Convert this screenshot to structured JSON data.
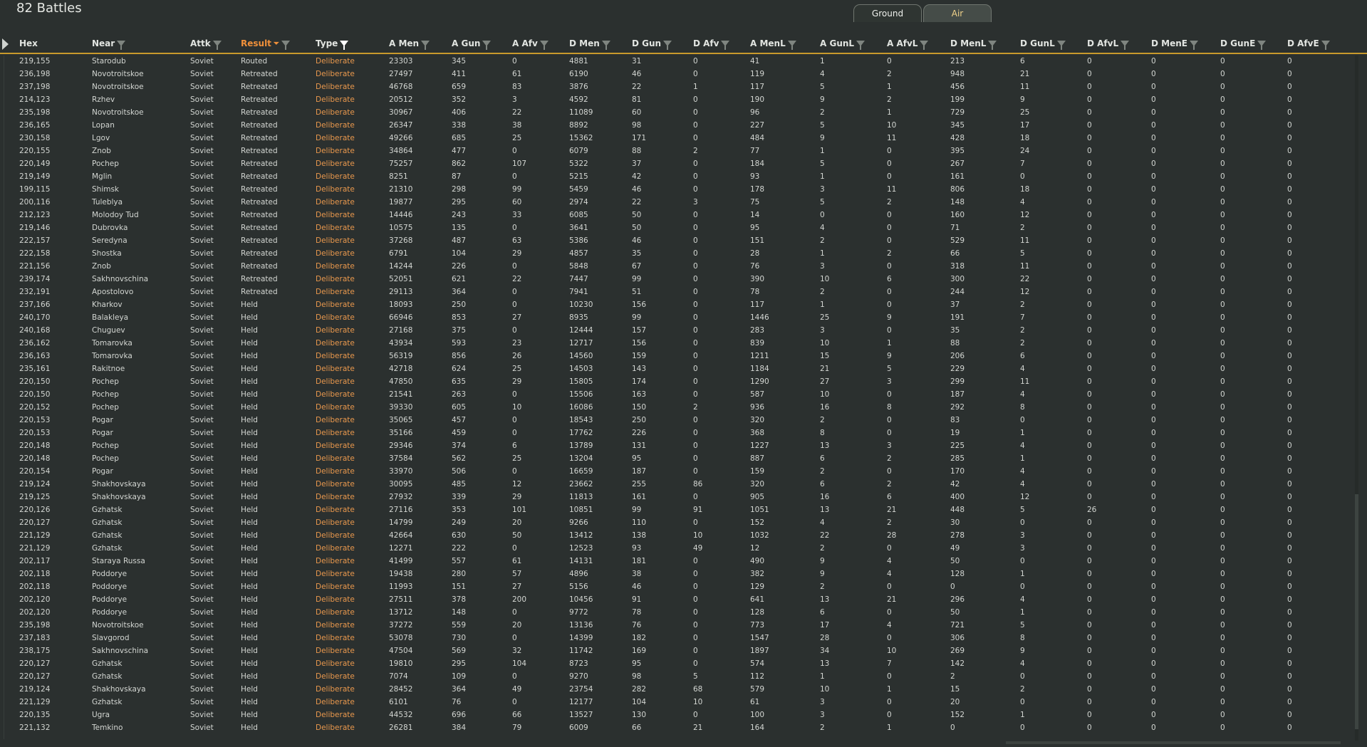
{
  "title": "82 Battles",
  "tabs": [
    {
      "label": "Ground"
    },
    {
      "label": "Air"
    }
  ],
  "columns": [
    "Hex",
    "Near",
    "Attk",
    "Result",
    "Type",
    "A Men",
    "A Gun",
    "A Afv",
    "D Men",
    "D Gun",
    "D Afv",
    "A MenL",
    "A GunL",
    "A AfvL",
    "D MenL",
    "D GunL",
    "D AfvL",
    "D MenE",
    "D GunE",
    "D AfvE"
  ],
  "rows": [
    [
      "219,155",
      "Starodub",
      "Soviet",
      "Routed",
      "Deliberate",
      "23303",
      "345",
      "0",
      "4881",
      "31",
      "0",
      "41",
      "1",
      "0",
      "213",
      "6",
      "0",
      "0",
      "0",
      "0"
    ],
    [
      "236,198",
      "Novotroitskoe",
      "Soviet",
      "Retreated",
      "Deliberate",
      "27497",
      "411",
      "61",
      "6190",
      "46",
      "0",
      "119",
      "4",
      "2",
      "948",
      "21",
      "0",
      "0",
      "0",
      "0"
    ],
    [
      "237,198",
      "Novotroitskoe",
      "Soviet",
      "Retreated",
      "Deliberate",
      "46768",
      "659",
      "83",
      "3876",
      "22",
      "1",
      "117",
      "5",
      "1",
      "456",
      "11",
      "0",
      "0",
      "0",
      "0"
    ],
    [
      "214,123",
      "Rzhev",
      "Soviet",
      "Retreated",
      "Deliberate",
      "20512",
      "352",
      "3",
      "4592",
      "81",
      "0",
      "190",
      "9",
      "2",
      "199",
      "9",
      "0",
      "0",
      "0",
      "0"
    ],
    [
      "235,198",
      "Novotroitskoe",
      "Soviet",
      "Retreated",
      "Deliberate",
      "30967",
      "406",
      "22",
      "11089",
      "60",
      "0",
      "96",
      "2",
      "1",
      "729",
      "25",
      "0",
      "0",
      "0",
      "0"
    ],
    [
      "236,165",
      "Lopan",
      "Soviet",
      "Retreated",
      "Deliberate",
      "26347",
      "338",
      "38",
      "8892",
      "98",
      "0",
      "227",
      "5",
      "10",
      "345",
      "17",
      "0",
      "0",
      "0",
      "0"
    ],
    [
      "230,158",
      "Lgov",
      "Soviet",
      "Retreated",
      "Deliberate",
      "49266",
      "685",
      "25",
      "15362",
      "171",
      "0",
      "484",
      "9",
      "11",
      "428",
      "18",
      "0",
      "0",
      "0",
      "0"
    ],
    [
      "220,155",
      "Znob",
      "Soviet",
      "Retreated",
      "Deliberate",
      "34864",
      "477",
      "0",
      "6079",
      "88",
      "2",
      "77",
      "1",
      "0",
      "395",
      "24",
      "0",
      "0",
      "0",
      "0"
    ],
    [
      "220,149",
      "Pochep",
      "Soviet",
      "Retreated",
      "Deliberate",
      "75257",
      "862",
      "107",
      "5322",
      "37",
      "0",
      "184",
      "5",
      "0",
      "267",
      "7",
      "0",
      "0",
      "0",
      "0"
    ],
    [
      "219,149",
      "Mglin",
      "Soviet",
      "Retreated",
      "Deliberate",
      "8251",
      "87",
      "0",
      "5215",
      "42",
      "0",
      "93",
      "1",
      "0",
      "161",
      "0",
      "0",
      "0",
      "0",
      "0"
    ],
    [
      "199,115",
      "Shimsk",
      "Soviet",
      "Retreated",
      "Deliberate",
      "21310",
      "298",
      "99",
      "5459",
      "46",
      "0",
      "178",
      "3",
      "11",
      "806",
      "18",
      "0",
      "0",
      "0",
      "0"
    ],
    [
      "200,116",
      "Tuleblya",
      "Soviet",
      "Retreated",
      "Deliberate",
      "19877",
      "295",
      "60",
      "2974",
      "22",
      "3",
      "75",
      "5",
      "2",
      "148",
      "4",
      "0",
      "0",
      "0",
      "0"
    ],
    [
      "212,123",
      "Molodoy Tud",
      "Soviet",
      "Retreated",
      "Deliberate",
      "14446",
      "243",
      "33",
      "6085",
      "50",
      "0",
      "14",
      "0",
      "0",
      "160",
      "12",
      "0",
      "0",
      "0",
      "0"
    ],
    [
      "219,146",
      "Dubrovka",
      "Soviet",
      "Retreated",
      "Deliberate",
      "10575",
      "135",
      "0",
      "3641",
      "50",
      "0",
      "95",
      "4",
      "0",
      "71",
      "2",
      "0",
      "0",
      "0",
      "0"
    ],
    [
      "222,157",
      "Seredyna",
      "Soviet",
      "Retreated",
      "Deliberate",
      "37268",
      "487",
      "63",
      "5386",
      "46",
      "0",
      "151",
      "2",
      "0",
      "529",
      "11",
      "0",
      "0",
      "0",
      "0"
    ],
    [
      "222,158",
      "Shostka",
      "Soviet",
      "Retreated",
      "Deliberate",
      "6791",
      "104",
      "29",
      "4857",
      "35",
      "0",
      "28",
      "1",
      "2",
      "66",
      "5",
      "0",
      "0",
      "0",
      "0"
    ],
    [
      "221,156",
      "Znob",
      "Soviet",
      "Retreated",
      "Deliberate",
      "14244",
      "226",
      "0",
      "5848",
      "67",
      "0",
      "76",
      "3",
      "0",
      "318",
      "11",
      "0",
      "0",
      "0",
      "0"
    ],
    [
      "239,174",
      "Sakhnovschina",
      "Soviet",
      "Retreated",
      "Deliberate",
      "52051",
      "621",
      "22",
      "7447",
      "99",
      "0",
      "390",
      "10",
      "6",
      "300",
      "22",
      "0",
      "0",
      "0",
      "0"
    ],
    [
      "232,191",
      "Apostolovo",
      "Soviet",
      "Retreated",
      "Deliberate",
      "29113",
      "364",
      "0",
      "7941",
      "51",
      "0",
      "78",
      "2",
      "0",
      "244",
      "12",
      "0",
      "0",
      "0",
      "0"
    ],
    [
      "237,166",
      "Kharkov",
      "Soviet",
      "Held",
      "Deliberate",
      "18093",
      "250",
      "0",
      "10230",
      "156",
      "0",
      "117",
      "1",
      "0",
      "37",
      "2",
      "0",
      "0",
      "0",
      "0"
    ],
    [
      "240,170",
      "Balakleya",
      "Soviet",
      "Held",
      "Deliberate",
      "66946",
      "853",
      "27",
      "8935",
      "99",
      "0",
      "1446",
      "25",
      "9",
      "191",
      "7",
      "0",
      "0",
      "0",
      "0"
    ],
    [
      "240,168",
      "Chuguev",
      "Soviet",
      "Held",
      "Deliberate",
      "27168",
      "375",
      "0",
      "12444",
      "157",
      "0",
      "283",
      "3",
      "0",
      "35",
      "2",
      "0",
      "0",
      "0",
      "0"
    ],
    [
      "236,162",
      "Tomarovka",
      "Soviet",
      "Held",
      "Deliberate",
      "43934",
      "593",
      "23",
      "12717",
      "156",
      "0",
      "839",
      "10",
      "1",
      "88",
      "2",
      "0",
      "0",
      "0",
      "0"
    ],
    [
      "236,163",
      "Tomarovka",
      "Soviet",
      "Held",
      "Deliberate",
      "56319",
      "856",
      "26",
      "14560",
      "159",
      "0",
      "1211",
      "15",
      "9",
      "206",
      "6",
      "0",
      "0",
      "0",
      "0"
    ],
    [
      "235,161",
      "Rakitnoe",
      "Soviet",
      "Held",
      "Deliberate",
      "42718",
      "624",
      "25",
      "14503",
      "143",
      "0",
      "1184",
      "21",
      "5",
      "229",
      "4",
      "0",
      "0",
      "0",
      "0"
    ],
    [
      "220,150",
      "Pochep",
      "Soviet",
      "Held",
      "Deliberate",
      "47850",
      "635",
      "29",
      "15805",
      "174",
      "0",
      "1290",
      "27",
      "3",
      "299",
      "11",
      "0",
      "0",
      "0",
      "0"
    ],
    [
      "220,150",
      "Pochep",
      "Soviet",
      "Held",
      "Deliberate",
      "21541",
      "263",
      "0",
      "15506",
      "163",
      "0",
      "587",
      "10",
      "0",
      "187",
      "4",
      "0",
      "0",
      "0",
      "0"
    ],
    [
      "220,152",
      "Pochep",
      "Soviet",
      "Held",
      "Deliberate",
      "39330",
      "605",
      "10",
      "16086",
      "150",
      "2",
      "936",
      "16",
      "8",
      "292",
      "8",
      "0",
      "0",
      "0",
      "0"
    ],
    [
      "220,153",
      "Pogar",
      "Soviet",
      "Held",
      "Deliberate",
      "35065",
      "457",
      "0",
      "18543",
      "250",
      "0",
      "320",
      "2",
      "0",
      "83",
      "0",
      "0",
      "0",
      "0",
      "0"
    ],
    [
      "220,153",
      "Pogar",
      "Soviet",
      "Held",
      "Deliberate",
      "35166",
      "459",
      "0",
      "17762",
      "226",
      "0",
      "368",
      "8",
      "0",
      "19",
      "1",
      "0",
      "0",
      "0",
      "0"
    ],
    [
      "220,148",
      "Pochep",
      "Soviet",
      "Held",
      "Deliberate",
      "29346",
      "374",
      "6",
      "13789",
      "131",
      "0",
      "1227",
      "13",
      "3",
      "225",
      "4",
      "0",
      "0",
      "0",
      "0"
    ],
    [
      "220,148",
      "Pochep",
      "Soviet",
      "Held",
      "Deliberate",
      "37584",
      "562",
      "25",
      "13204",
      "95",
      "0",
      "887",
      "6",
      "2",
      "285",
      "1",
      "0",
      "0",
      "0",
      "0"
    ],
    [
      "220,154",
      "Pogar",
      "Soviet",
      "Held",
      "Deliberate",
      "33970",
      "506",
      "0",
      "16659",
      "187",
      "0",
      "159",
      "2",
      "0",
      "170",
      "4",
      "0",
      "0",
      "0",
      "0"
    ],
    [
      "219,124",
      "Shakhovskaya",
      "Soviet",
      "Held",
      "Deliberate",
      "30095",
      "485",
      "12",
      "23662",
      "255",
      "86",
      "320",
      "6",
      "2",
      "42",
      "4",
      "0",
      "0",
      "0",
      "0"
    ],
    [
      "219,125",
      "Shakhovskaya",
      "Soviet",
      "Held",
      "Deliberate",
      "27932",
      "339",
      "29",
      "11813",
      "161",
      "0",
      "905",
      "16",
      "6",
      "400",
      "12",
      "0",
      "0",
      "0",
      "0"
    ],
    [
      "220,126",
      "Gzhatsk",
      "Soviet",
      "Held",
      "Deliberate",
      "27116",
      "353",
      "101",
      "10851",
      "99",
      "91",
      "1051",
      "13",
      "21",
      "448",
      "5",
      "26",
      "0",
      "0",
      "0"
    ],
    [
      "220,127",
      "Gzhatsk",
      "Soviet",
      "Held",
      "Deliberate",
      "14799",
      "249",
      "20",
      "9266",
      "110",
      "0",
      "152",
      "4",
      "2",
      "30",
      "0",
      "0",
      "0",
      "0",
      "0"
    ],
    [
      "221,129",
      "Gzhatsk",
      "Soviet",
      "Held",
      "Deliberate",
      "42664",
      "630",
      "50",
      "13412",
      "138",
      "10",
      "1032",
      "22",
      "28",
      "278",
      "3",
      "0",
      "0",
      "0",
      "0"
    ],
    [
      "221,129",
      "Gzhatsk",
      "Soviet",
      "Held",
      "Deliberate",
      "12271",
      "222",
      "0",
      "12523",
      "93",
      "49",
      "12",
      "2",
      "0",
      "49",
      "3",
      "0",
      "0",
      "0",
      "0"
    ],
    [
      "202,117",
      "Staraya Russa",
      "Soviet",
      "Held",
      "Deliberate",
      "41499",
      "557",
      "61",
      "14131",
      "181",
      "0",
      "490",
      "9",
      "4",
      "50",
      "0",
      "0",
      "0",
      "0",
      "0"
    ],
    [
      "202,118",
      "Poddorye",
      "Soviet",
      "Held",
      "Deliberate",
      "19438",
      "280",
      "57",
      "4896",
      "38",
      "0",
      "382",
      "9",
      "4",
      "128",
      "1",
      "0",
      "0",
      "0",
      "0"
    ],
    [
      "202,118",
      "Poddorye",
      "Soviet",
      "Held",
      "Deliberate",
      "11993",
      "151",
      "27",
      "5156",
      "46",
      "0",
      "129",
      "2",
      "0",
      "0",
      "0",
      "0",
      "0",
      "0",
      "0"
    ],
    [
      "202,120",
      "Poddorye",
      "Soviet",
      "Held",
      "Deliberate",
      "27511",
      "378",
      "200",
      "10456",
      "91",
      "0",
      "641",
      "13",
      "21",
      "296",
      "4",
      "0",
      "0",
      "0",
      "0"
    ],
    [
      "202,120",
      "Poddorye",
      "Soviet",
      "Held",
      "Deliberate",
      "13712",
      "148",
      "0",
      "9772",
      "78",
      "0",
      "128",
      "6",
      "0",
      "50",
      "1",
      "0",
      "0",
      "0",
      "0"
    ],
    [
      "235,198",
      "Novotroitskoe",
      "Soviet",
      "Held",
      "Deliberate",
      "37272",
      "559",
      "20",
      "13136",
      "76",
      "0",
      "773",
      "17",
      "4",
      "721",
      "5",
      "0",
      "0",
      "0",
      "0"
    ],
    [
      "237,183",
      "Slavgorod",
      "Soviet",
      "Held",
      "Deliberate",
      "53078",
      "730",
      "0",
      "14399",
      "182",
      "0",
      "1547",
      "28",
      "0",
      "306",
      "8",
      "0",
      "0",
      "0",
      "0"
    ],
    [
      "238,175",
      "Sakhnovschina",
      "Soviet",
      "Held",
      "Deliberate",
      "47504",
      "569",
      "32",
      "11742",
      "169",
      "0",
      "1897",
      "34",
      "10",
      "269",
      "9",
      "0",
      "0",
      "0",
      "0"
    ],
    [
      "220,127",
      "Gzhatsk",
      "Soviet",
      "Held",
      "Deliberate",
      "19810",
      "295",
      "104",
      "8723",
      "95",
      "0",
      "574",
      "13",
      "7",
      "142",
      "4",
      "0",
      "0",
      "0",
      "0"
    ],
    [
      "220,127",
      "Gzhatsk",
      "Soviet",
      "Held",
      "Deliberate",
      "7074",
      "109",
      "0",
      "9270",
      "98",
      "5",
      "112",
      "1",
      "0",
      "2",
      "0",
      "0",
      "0",
      "0",
      "0"
    ],
    [
      "219,124",
      "Shakhovskaya",
      "Soviet",
      "Held",
      "Deliberate",
      "28452",
      "364",
      "49",
      "23754",
      "282",
      "68",
      "579",
      "10",
      "1",
      "15",
      "2",
      "0",
      "0",
      "0",
      "0"
    ],
    [
      "221,129",
      "Gzhatsk",
      "Soviet",
      "Held",
      "Deliberate",
      "6101",
      "76",
      "0",
      "12177",
      "104",
      "10",
      "61",
      "3",
      "0",
      "20",
      "0",
      "0",
      "0",
      "0",
      "0"
    ],
    [
      "220,135",
      "Ugra",
      "Soviet",
      "Held",
      "Deliberate",
      "44532",
      "696",
      "66",
      "13527",
      "130",
      "0",
      "100",
      "3",
      "0",
      "152",
      "1",
      "0",
      "0",
      "0",
      "0"
    ],
    [
      "221,132",
      "Temkino",
      "Soviet",
      "Held",
      "Deliberate",
      "26281",
      "384",
      "79",
      "6009",
      "66",
      "21",
      "164",
      "2",
      "1",
      "0",
      "0",
      "0",
      "0",
      "0",
      "0"
    ]
  ]
}
